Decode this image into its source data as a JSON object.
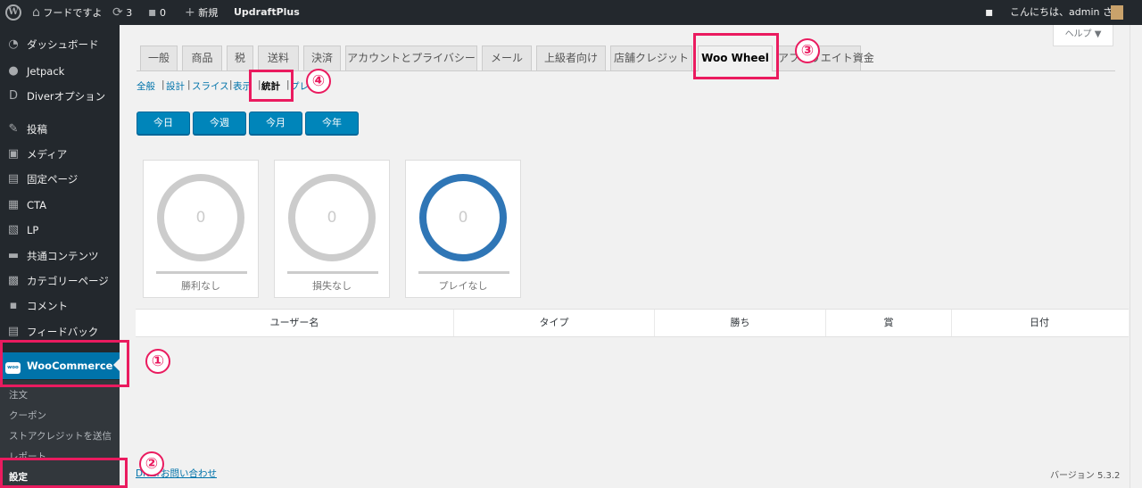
{
  "adminbar": {
    "site_name": "フードですよ",
    "updates_count": "3",
    "comments_count": "0",
    "new_label": "新規",
    "plugin_label": "UpdraftPlus",
    "greeting": "こんにちは、admin さん",
    "icons": {
      "logo": "wordpress-logo-icon",
      "home": "home-icon",
      "updates": "refresh-icon",
      "comments": "comment-bubble-icon",
      "new": "plus-icon",
      "notifications": "notification-icon"
    }
  },
  "sidebar": {
    "items": [
      {
        "label": "ダッシュボード",
        "icon": "dashboard-icon"
      },
      {
        "label": "Jetpack",
        "icon": "jetpack-icon"
      },
      {
        "label": "Diverオプション",
        "icon": "diver-icon"
      },
      {
        "label": "投稿",
        "icon": "pin-icon"
      },
      {
        "label": "メディア",
        "icon": "media-icon"
      },
      {
        "label": "固定ページ",
        "icon": "page-icon"
      },
      {
        "label": "CTA",
        "icon": "cta-icon"
      },
      {
        "label": "LP",
        "icon": "lp-icon"
      },
      {
        "label": "共通コンテンツ",
        "icon": "folder-icon"
      },
      {
        "label": "カテゴリーページ",
        "icon": "grid-icon"
      },
      {
        "label": "コメント",
        "icon": "comment-icon"
      },
      {
        "label": "フィードバック",
        "icon": "feedback-icon"
      }
    ],
    "active": {
      "label": "WooCommerce",
      "badge": "woo"
    },
    "submenu": [
      "注文",
      "クーポン",
      "ストアクレジットを送信",
      "レポート",
      "設定"
    ]
  },
  "help_label": "ヘルプ ▼",
  "tabs": [
    "一般",
    "商品",
    "税",
    "送料",
    "決済",
    "アカウントとプライバシー",
    "メール",
    "上級者向け",
    "店舗クレジット",
    "Woo Wheel",
    "アフィリエイト資金"
  ],
  "sublinks": [
    "全般",
    "設計",
    "スライス",
    "表示",
    "統計",
    "プレ"
  ],
  "periods": [
    "今日",
    "今週",
    "今月",
    "今年"
  ],
  "stats": [
    {
      "value": "0",
      "label": "勝利なし"
    },
    {
      "value": "0",
      "label": "損失なし"
    },
    {
      "value": "0",
      "label": "プレイなし"
    }
  ],
  "table": {
    "columns": [
      "ユーザー名",
      "タイプ",
      "勝ち",
      "賞",
      "日付"
    ]
  },
  "footer": {
    "link": "Diverお問い合わせ",
    "version": "バージョン 5.3.2"
  },
  "annotations": [
    "①",
    "②",
    "③",
    "④"
  ],
  "colors": {
    "accent": "#0073aa",
    "highlight": "#ea1b5f",
    "button": "#0085ba",
    "ring_active": "#2f76b6"
  }
}
